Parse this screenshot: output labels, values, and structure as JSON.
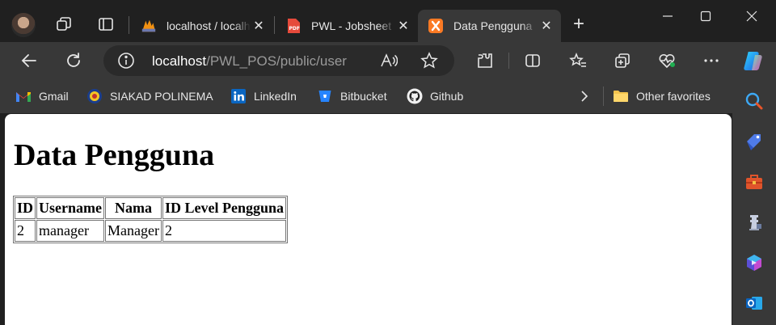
{
  "tabs": [
    {
      "title": "localhost / localhost / pma",
      "favicon": "phpmyadmin-icon"
    },
    {
      "title": "PWL - Jobsheet",
      "favicon": "pdf-icon"
    },
    {
      "title": "Data Pengguna",
      "favicon": "xampp-icon",
      "active": true
    }
  ],
  "address_bar": {
    "host": "localhost",
    "path": "/PWL_POS/public/user"
  },
  "favorites": [
    {
      "label": "Gmail",
      "icon": "gmail-icon"
    },
    {
      "label": "SIAKAD POLINEMA",
      "icon": "polinema-icon"
    },
    {
      "label": "LinkedIn",
      "icon": "linkedin-icon"
    },
    {
      "label": "Bitbucket",
      "icon": "bitbucket-icon"
    },
    {
      "label": "Github",
      "icon": "github-icon"
    }
  ],
  "other_favorites": "Other favorites",
  "page": {
    "heading": "Data Pengguna",
    "columns": [
      "ID",
      "Username",
      "Nama",
      "ID Level Pengguna"
    ],
    "rows": [
      [
        "2",
        "manager",
        "Manager",
        "2"
      ]
    ]
  },
  "colors": {
    "tabstrip_bg": "#202020",
    "toolbar_bg": "#383838",
    "accent_blue": "#2f7fd1"
  }
}
